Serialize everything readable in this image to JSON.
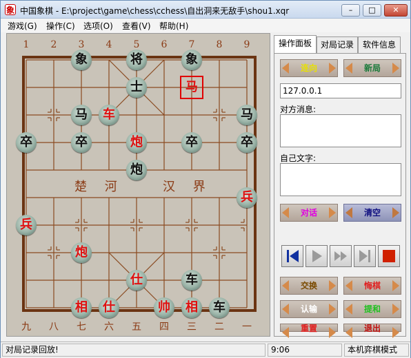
{
  "window": {
    "title": "中国象棋 - E:\\project\\game\\chess\\cchess\\自出洞来无敌手\\shou1.xqr",
    "app_icon": "象",
    "minimize_glyph": "–",
    "maximize_glyph": "□",
    "close_glyph": "✕"
  },
  "menu": [
    "游戏(G)",
    "操作(C)",
    "选项(O)",
    "查看(V)",
    "帮助(H)"
  ],
  "board": {
    "top_numbers": [
      "1",
      "2",
      "3",
      "4",
      "5",
      "6",
      "7",
      "8",
      "9"
    ],
    "bottom_numbers": [
      "九",
      "八",
      "七",
      "六",
      "五",
      "四",
      "三",
      "二",
      "一"
    ],
    "river_left": "楚 河",
    "river_right": "汉 界",
    "pieces": [
      {
        "char": "象",
        "color": "black",
        "col": 2,
        "row": 0
      },
      {
        "char": "将",
        "color": "black",
        "col": 4,
        "row": 0
      },
      {
        "char": "象",
        "color": "black",
        "col": 6,
        "row": 0
      },
      {
        "char": "士",
        "color": "black",
        "col": 4,
        "row": 1
      },
      {
        "char": "马",
        "color": "red",
        "col": 6,
        "row": 1,
        "selected": true
      },
      {
        "char": "马",
        "color": "black",
        "col": 2,
        "row": 2
      },
      {
        "char": "车",
        "color": "red",
        "col": 3,
        "row": 2
      },
      {
        "char": "马",
        "color": "black",
        "col": 8,
        "row": 2
      },
      {
        "char": "卒",
        "color": "black",
        "col": 0,
        "row": 3
      },
      {
        "char": "卒",
        "color": "black",
        "col": 2,
        "row": 3
      },
      {
        "char": "炮",
        "color": "red",
        "col": 4,
        "row": 3
      },
      {
        "char": "卒",
        "color": "black",
        "col": 6,
        "row": 3
      },
      {
        "char": "卒",
        "color": "black",
        "col": 8,
        "row": 3
      },
      {
        "char": "炮",
        "color": "black",
        "col": 4,
        "row": 4
      },
      {
        "char": "兵",
        "color": "red",
        "col": 8,
        "row": 5
      },
      {
        "char": "兵",
        "color": "red",
        "col": 0,
        "row": 6
      },
      {
        "char": "炮",
        "color": "red",
        "col": 2,
        "row": 7
      },
      {
        "char": "仕",
        "color": "red",
        "col": 4,
        "row": 8
      },
      {
        "char": "车",
        "color": "black",
        "col": 6,
        "row": 8
      },
      {
        "char": "相",
        "color": "red",
        "col": 2,
        "row": 9
      },
      {
        "char": "仕",
        "color": "red",
        "col": 3,
        "row": 9
      },
      {
        "char": "帅",
        "color": "red",
        "col": 5,
        "row": 9
      },
      {
        "char": "相",
        "color": "red",
        "col": 6,
        "row": 9
      },
      {
        "char": "车",
        "color": "black",
        "col": 7,
        "row": 9
      }
    ]
  },
  "tabs": [
    "操作面板",
    "对局记录",
    "软件信息"
  ],
  "panel": {
    "btn_connect": "连向",
    "btn_new": "新局",
    "ip_value": "127.0.0.1",
    "opponent_label": "对方消息:",
    "self_label": "自己文字:",
    "btn_talk": "对话",
    "btn_clear": "清空",
    "btn_swap": "交换",
    "btn_undo": "悔棋",
    "btn_resign": "认输",
    "btn_draw": "提和",
    "btn_reset": "重置",
    "btn_exit": "退出"
  },
  "colors": {
    "connect_text": "#e8e000",
    "new_text": "#1a7a3a",
    "talk_text": "#e000e0",
    "clear_text": "#101080",
    "swap_text": "#7a4a00",
    "undo_text": "#e02020",
    "resign_text": "#ffffff",
    "draw_text": "#20c020",
    "reset_text": "#e02020",
    "exit_text": "#c01010",
    "nav_blue": "#1030a0",
    "stop_red": "#d02000"
  },
  "status": {
    "message": "对局记录回放!",
    "time": "9:06",
    "mode": "本机弈棋模式"
  }
}
